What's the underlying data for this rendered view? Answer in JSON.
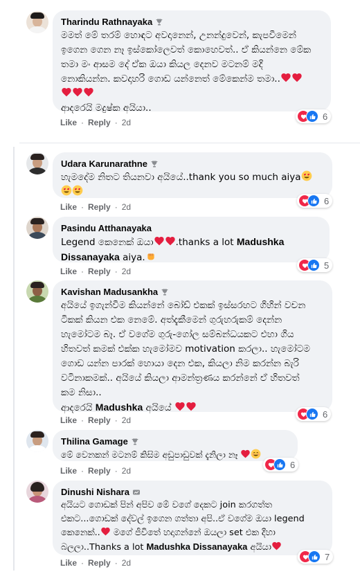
{
  "actions": {
    "like": "Like",
    "reply": "Reply",
    "separator": "·"
  },
  "comments": [
    {
      "name": "Tharindu Rathnayaka",
      "text_lines": [
        "මමත් මේ තරම් හොඳට අවදානෙන්, උනන්දුවෙන්, කැපවීමෙන්",
        "ඉගෙන ගෙන නෑ ඉස්කෝලෙවත් කොහෙවත්.. ඒ කියන්නෙ මේක",
        "තමා මං ආසම දේ ඒක ඔයා කියල දෙනව මටනම් මදි",
        "නොකියන්න. කවදාහරි ගොඩ යන්නෙත් මේකෙන්ම තමා..",
        "",
        "ආදරෙයි මදුෂ්ක අයියා.."
      ],
      "time": "2d",
      "reaction_count": "6",
      "badge": "top-fan-icon"
    },
    {
      "name": "Udara Karunarathne",
      "text_lines": [
        "හැමදේම නිතට තියනවා අයියේ..thank you so much aiya"
      ],
      "time": "2d",
      "reaction_count": "6",
      "badge": "top-fan-icon"
    },
    {
      "name": "Pasindu Atthanayaka",
      "text_a": "Legend කෙනෙක් ඔයා",
      "text_b": ".thanks a lot ",
      "mention": "Madushka Dissanayaka",
      "text_c": " aiya.",
      "time": "2d",
      "reaction_count": "5"
    },
    {
      "name": "Kavishan Madusankha",
      "text_lines": [
        "අයියේ ඉගැන්වීම කියන්නේ බෝඩ් එකක් ඉස්සරහට ගිහින් වචන",
        "ටිකක් කියන එක නෙමේ. අත්දැකීමෙන් ගුරුහරුකම් දෙන්න",
        "හැමෝටම බෑ. ඒ වගේම ගුරු-ගෝල සම්බන්ධයකට එහා ගිය",
        "හිතවත් කමක් එක්ක හැමෝමව motivation කරලා.. හැමෝටම",
        "ගොඩ යන්න පාරක් හොයා දෙන එක, කියලා නිම කරන්න බැරි",
        "වටිනාකමක්.. අයියේ කියලා ආමන්ත්‍රණය කරන්නේ ඒ හිතවත්",
        "කම නිසා.."
      ],
      "last_a": "ආදරෙයි ",
      "last_mention": "Madushka",
      "last_b": " අයියේ ",
      "time": "2d",
      "reaction_count": "6",
      "badge": "top-fan-icon"
    },
    {
      "name": "Thilina Gamage",
      "text_lines": [
        "මේ වෙනකන් මටනම් කිසිම අඩුපාඩුවක් දැනිලා නෑ "
      ],
      "time": "2d",
      "reaction_count": "6",
      "badge": "top-fan-icon"
    },
    {
      "name": "Dinushi Nishara",
      "text_lines": [
        "අයියට ගොඩක් පින් අපිව මේ වගේ දෙකට join කරගත්ත",
        "එකට...ගොඩක් දේවල් ඉගෙන ගත්තා අපි..ඒ වගේම ඔයා legend",
        "කෙනෙක්.."
      ],
      "line3_b": " මගේ ජීවිතේ හදාගන්නේ ඔයලා set එක දීහා",
      "line4_a": "බලලා..Thanks a lot ",
      "mention": "Madushka Dissanayaka",
      "line4_b": " අයියා",
      "time": "2d",
      "reaction_count": "7",
      "badge": "rising-fan-icon"
    }
  ],
  "colors": {
    "bubble": "#f0f2f5",
    "meta": "#65676b",
    "love": "#f02849",
    "like": "#1877f2"
  }
}
